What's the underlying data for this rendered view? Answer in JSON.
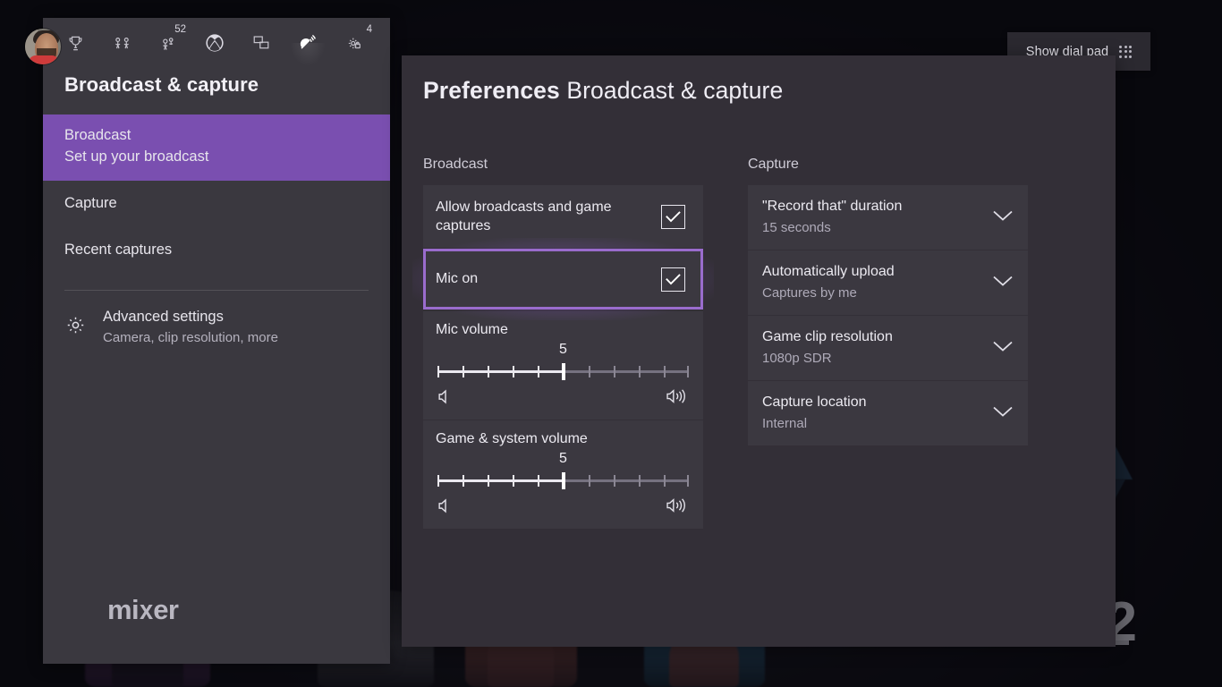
{
  "overlay": {
    "dial_pad": {
      "label": "Show dial pad",
      "icon": "dial-pad-grid-icon"
    }
  },
  "sidebar": {
    "title": "Broadcast & capture",
    "topbar_icons": [
      {
        "name": "trophy-icon",
        "badge": ""
      },
      {
        "name": "multiplayer-group-icon",
        "badge": ""
      },
      {
        "name": "friends-icon",
        "badge": "52"
      },
      {
        "name": "xbox-logo-icon",
        "badge": ""
      },
      {
        "name": "chat-icon",
        "badge": ""
      },
      {
        "name": "broadcast-capture-icon",
        "badge": ""
      },
      {
        "name": "settings-gear-icon",
        "badge": "4"
      }
    ],
    "nav": [
      {
        "title": "Broadcast",
        "subtitle": "Set up your broadcast",
        "selected": true
      },
      {
        "title": "Capture",
        "subtitle": "",
        "selected": false
      },
      {
        "title": "Recent captures",
        "subtitle": "",
        "selected": false
      }
    ],
    "advanced": {
      "title": "Advanced settings",
      "subtitle": "Camera, clip resolution, more",
      "icon": "gear-icon"
    },
    "brand": {
      "part1": "mi",
      "part2": "x",
      "part3": "er"
    }
  },
  "panel": {
    "header_bold": "Preferences",
    "header_rest": "Broadcast & capture",
    "broadcast": {
      "heading": "Broadcast",
      "rows": [
        {
          "label": "Allow broadcasts and game captures",
          "checked": true,
          "focused": false
        },
        {
          "label": "Mic on",
          "checked": true,
          "focused": true
        }
      ],
      "sliders": [
        {
          "label": "Mic volume",
          "value": "5",
          "min": 0,
          "max": 10,
          "mute_icon": "speaker-mute-icon",
          "loud_icon": "speaker-high-icon"
        },
        {
          "label": "Game & system volume",
          "value": "5",
          "min": 0,
          "max": 10,
          "mute_icon": "speaker-mute-icon",
          "loud_icon": "speaker-high-icon"
        }
      ]
    },
    "capture": {
      "heading": "Capture",
      "rows": [
        {
          "label": "\"Record that\" duration",
          "value": "15 seconds",
          "icon": "chevron-down-icon"
        },
        {
          "label": "Automatically upload",
          "value": "Captures by me",
          "icon": "chevron-down-icon"
        },
        {
          "label": "Game clip resolution",
          "value": "1080p SDR",
          "icon": "chevron-down-icon"
        },
        {
          "label": "Capture location",
          "value": "Internal",
          "icon": "chevron-down-icon"
        }
      ]
    }
  },
  "background": {
    "hud_number": "2"
  },
  "colors": {
    "accent_purple": "#7a4fb0",
    "focus_purple": "#9a6ccd",
    "sidebar_bg": "#3a383f",
    "panel_bg": "#332f37",
    "card_bg": "#3b3840",
    "text_primary": "#eceaf1",
    "text_secondary": "#aeaab8"
  }
}
